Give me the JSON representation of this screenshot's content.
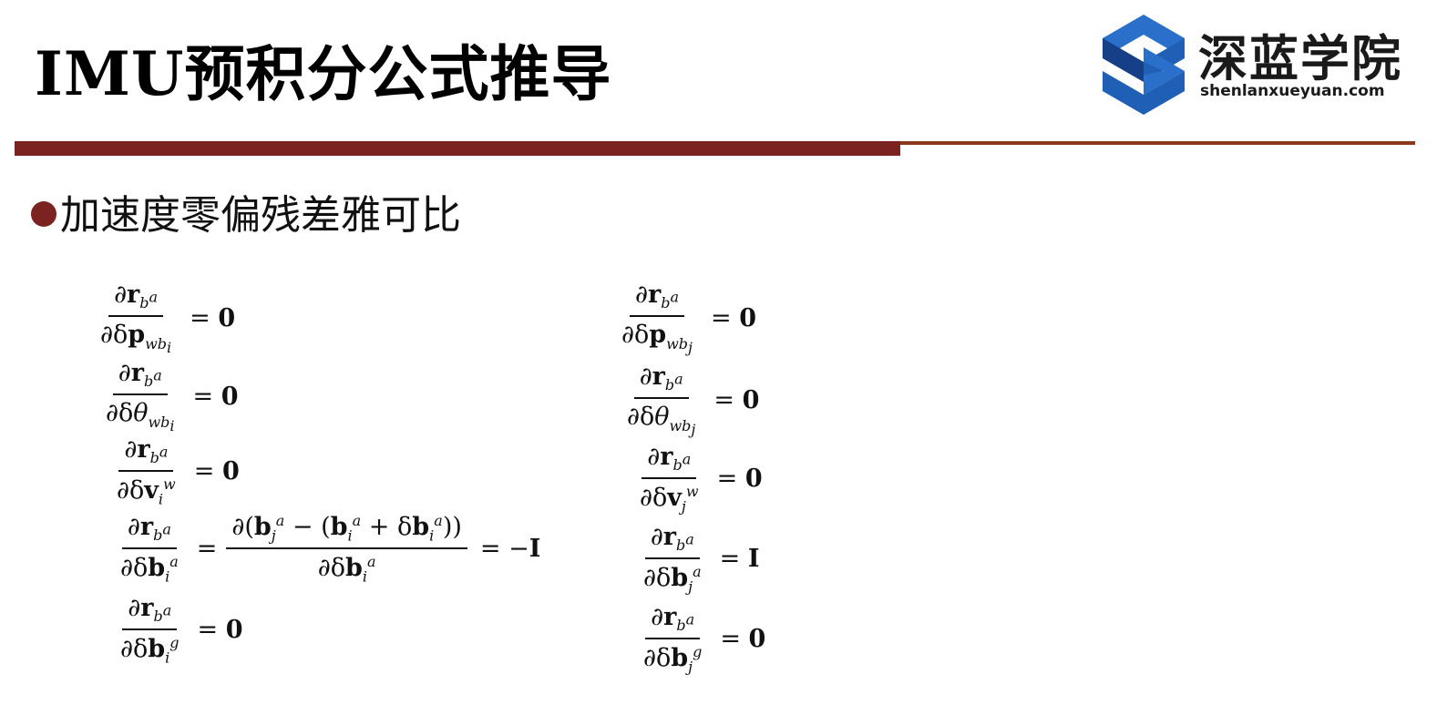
{
  "slide": {
    "title": "IMU预积分公式推导",
    "bullet": "加速度零偏残差雅可比"
  },
  "logo": {
    "name_cn": "深蓝学院",
    "url_text": "shenlanxueyuan.com",
    "colors": {
      "primary": "#1f5fb5",
      "dark": "#153f86"
    }
  },
  "colors": {
    "accent": "#7b2320"
  },
  "equations": {
    "left": [
      {
        "lhs_num": "∂r",
        "lhs_num_sub": "b",
        "lhs_num_sup": "a",
        "lhs_den": "∂δp",
        "lhs_den_sub": "wb",
        "lhs_den_sub2": "i",
        "rhs": "= 0"
      },
      {
        "lhs_num": "∂r",
        "lhs_num_sub": "b",
        "lhs_num_sup": "a",
        "lhs_den": "∂δθ",
        "lhs_den_sub": "wb",
        "lhs_den_sub2": "i",
        "rhs": "= 0"
      },
      {
        "lhs_num": "∂r",
        "lhs_num_sub": "b",
        "lhs_num_sup": "a",
        "lhs_den": "∂δv",
        "lhs_den_sub": "i",
        "lhs_den_sup": "w",
        "rhs": "= 0"
      },
      {
        "lhs_num": "∂r",
        "lhs_num_sub": "b",
        "lhs_num_sup": "a",
        "lhs_den": "∂δb",
        "lhs_den_sub": "i",
        "lhs_den_sup": "a",
        "mid_num": "∂(b",
        "mid_num_rest": " − (b",
        "mid_num_rest2": " + δb",
        "mid_den": "∂δb",
        "rhs": "= −I"
      },
      {
        "lhs_num": "∂r",
        "lhs_num_sub": "b",
        "lhs_num_sup": "a",
        "lhs_den": "∂δb",
        "lhs_den_sub": "i",
        "lhs_den_sup": "g",
        "rhs": "= 0"
      }
    ],
    "right": [
      {
        "lhs_num": "∂r",
        "lhs_num_sub": "b",
        "lhs_num_sup": "a",
        "lhs_den": "∂δp",
        "lhs_den_sub": "wb",
        "lhs_den_sub2": "j",
        "rhs": "= 0"
      },
      {
        "lhs_num": "∂r",
        "lhs_num_sub": "b",
        "lhs_num_sup": "a",
        "lhs_den": "∂δθ",
        "lhs_den_sub": "wb",
        "lhs_den_sub2": "j",
        "rhs": "= 0"
      },
      {
        "lhs_num": "∂r",
        "lhs_num_sub": "b",
        "lhs_num_sup": "a",
        "lhs_den": "∂δv",
        "lhs_den_sub": "j",
        "lhs_den_sup": "w",
        "rhs": "= 0"
      },
      {
        "lhs_num": "∂r",
        "lhs_num_sub": "b",
        "lhs_num_sup": "a",
        "lhs_den": "∂δb",
        "lhs_den_sub": "j",
        "lhs_den_sup": "a",
        "rhs": "= I"
      },
      {
        "lhs_num": "∂r",
        "lhs_num_sub": "b",
        "lhs_num_sup": "a",
        "lhs_den": "∂δb",
        "lhs_den_sub": "j",
        "lhs_den_sup": "g",
        "rhs": "= 0"
      }
    ]
  }
}
